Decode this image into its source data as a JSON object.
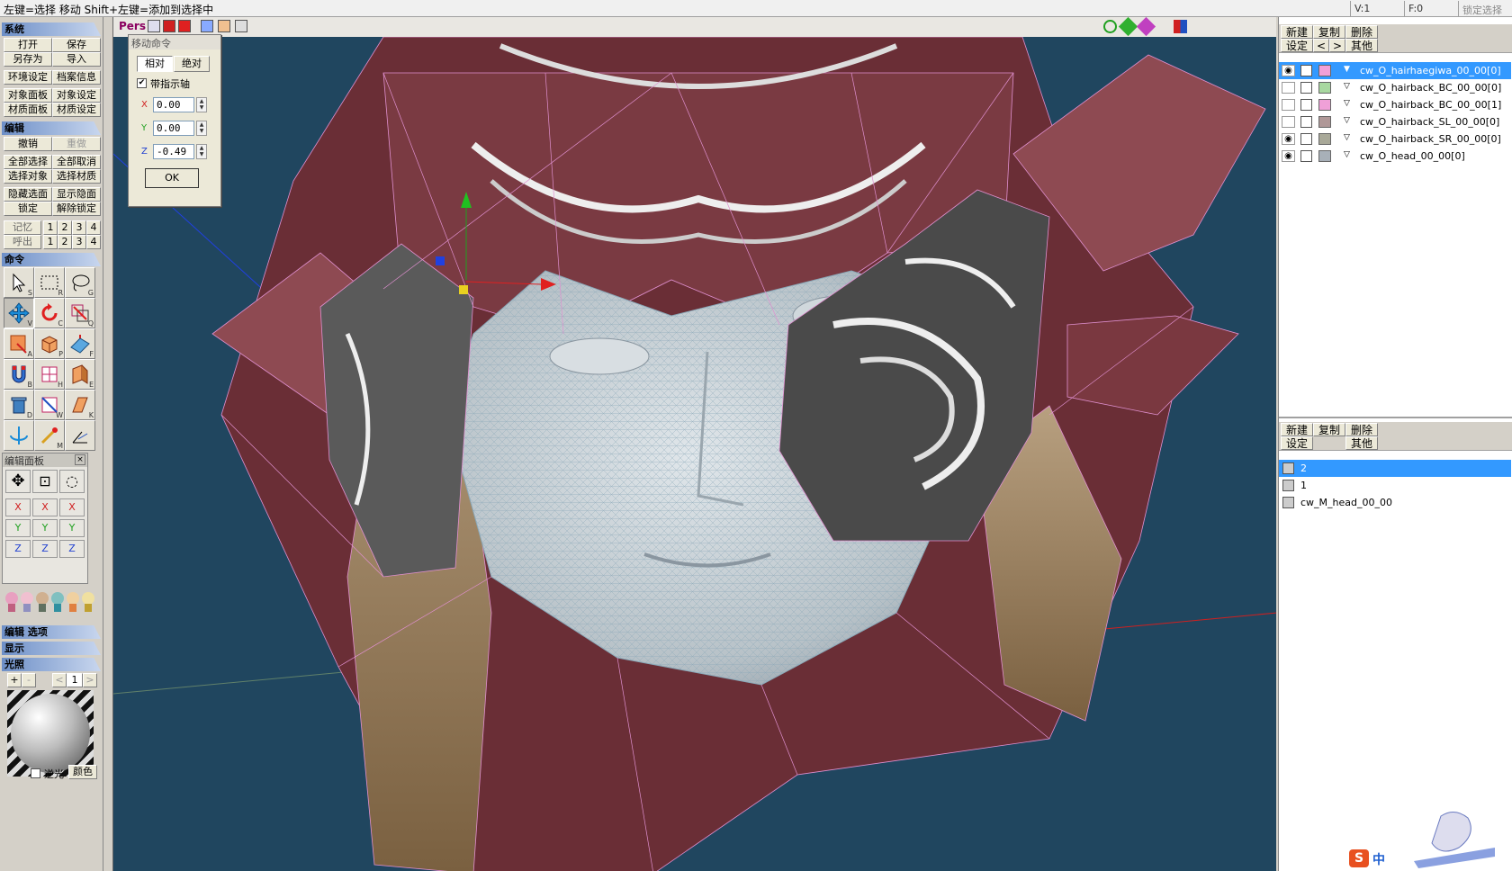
{
  "status": {
    "hint": "左键=选择 移动  Shift+左键=添加到选择中",
    "v_count": "V:1",
    "f_count": "F:0",
    "lock_select": "锁定选择"
  },
  "left": {
    "sec_system": "系统",
    "open": "打开",
    "save": "保存",
    "save_as": "另存为",
    "import": "导入",
    "env_settings": "环境设定",
    "file_info": "档案信息",
    "object_panel": "对象面板",
    "object_settings": "对象设定",
    "material_panel": "材质面板",
    "material_settings": "材质设定",
    "sec_edit": "编辑",
    "undo": "撤销",
    "redo": "重做",
    "select_all": "全部选择",
    "deselect_all": "全部取消",
    "select_object": "选择对象",
    "select_material": "选择材质",
    "hide_face": "隐藏选面",
    "show_hidden": "显示隐面",
    "lock": "锁定",
    "unlock": "解除锁定",
    "memory": "记忆",
    "recall": "呼出",
    "nums": [
      "1",
      "2",
      "3",
      "4"
    ],
    "sec_command": "命令",
    "tool_keys": [
      "S",
      "R",
      "G",
      "V",
      "C",
      "Q",
      "A",
      "P",
      "F",
      "B",
      "H",
      "E",
      "D",
      "W",
      "K",
      "",
      "M",
      ""
    ],
    "edit_panel": "编辑面板",
    "axis": [
      "X",
      "Y",
      "Z"
    ],
    "sec_edit_options": "编辑 选项",
    "sec_display": "显示",
    "sec_light": "光照",
    "light_plus": "+",
    "light_minus": "-",
    "light_prev": "<",
    "light_num": "1",
    "light_next": ">",
    "backlight": "逆光",
    "color": "颜色"
  },
  "viewport": {
    "mode": "Pers"
  },
  "move_dialog": {
    "title": "移动命令",
    "relative": "相对",
    "absolute": "绝对",
    "with_axis": "带指示轴",
    "x_label": "X",
    "y_label": "Y",
    "z_label": "Z",
    "x_value": "0.00",
    "y_value": "0.00",
    "z_value": "-0.49",
    "ok": "OK"
  },
  "objects_panel": {
    "new": "新建",
    "copy": "复制",
    "delete": "删除",
    "settings": "设定",
    "prev": "<",
    "next": ">",
    "other": "其他",
    "items": [
      {
        "name": "cw_O_hairhaegiwa_00_00[0]",
        "color": "#f2a0d8",
        "visible": true,
        "selected": true
      },
      {
        "name": "cw_O_hairback_BC_00_00[0]",
        "color": "#a8d8a0",
        "visible": false,
        "selected": false
      },
      {
        "name": "cw_O_hairback_BC_00_00[1]",
        "color": "#f0a0d8",
        "visible": false,
        "selected": false
      },
      {
        "name": "cw_O_hairback_SL_00_00[0]",
        "color": "#b09898",
        "visible": false,
        "selected": false
      },
      {
        "name": "cw_O_hairback_SR_00_00[0]",
        "color": "#a8a898",
        "visible": true,
        "selected": false
      },
      {
        "name": "cw_O_head_00_00[0]",
        "color": "#a8b0b8",
        "visible": true,
        "selected": false
      }
    ]
  },
  "materials_panel": {
    "new": "新建",
    "copy": "复制",
    "delete": "删除",
    "settings": "设定",
    "other": "其他",
    "items": [
      {
        "name": "2",
        "selected": true
      },
      {
        "name": "1",
        "selected": false
      },
      {
        "name": "cw_M_head_00_00",
        "selected": false
      }
    ]
  },
  "taskbar": {
    "ime": "中"
  }
}
